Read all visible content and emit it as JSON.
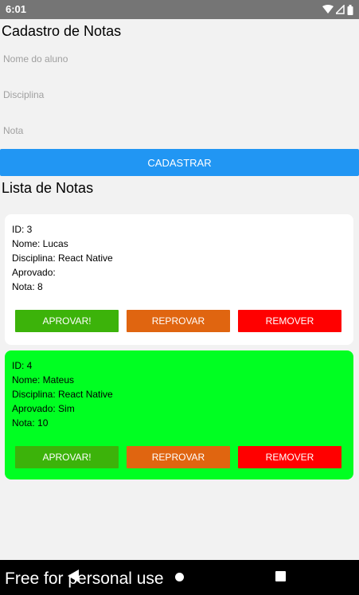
{
  "statusbar": {
    "time": "6:01"
  },
  "form": {
    "title": "Cadastro de Notas",
    "aluno_placeholder": "Nome do aluno",
    "disciplina_placeholder": "Disciplina",
    "nota_placeholder": "Nota",
    "submit_label": "CADASTRAR"
  },
  "list": {
    "title": "Lista de Notas",
    "cards": [
      {
        "id": "ID: 3",
        "nome": "Nome: Lucas",
        "disciplina": "Disciplina: React Native",
        "aprovado": "Aprovado:",
        "nota": "Nota: 8",
        "background": "#ffffff",
        "aprovar_label": "APROVAR!",
        "reprovar_label": "REPROVAR",
        "remover_label": "REMOVER"
      },
      {
        "id": "ID: 4",
        "nome": "Nome: Mateus",
        "disciplina": "Disciplina: React Native",
        "aprovado": "Aprovado: Sim",
        "nota": "Nota: 10",
        "background": "#00ff22",
        "aprovar_label": "APROVAR!",
        "reprovar_label": "REPROVAR",
        "remover_label": "REMOVER"
      }
    ]
  },
  "colors": {
    "primary": "#2196f3",
    "approve": "#3cb30a",
    "reprove": "#e06510",
    "remove": "#ff0000"
  },
  "watermark": "Free for personal use"
}
